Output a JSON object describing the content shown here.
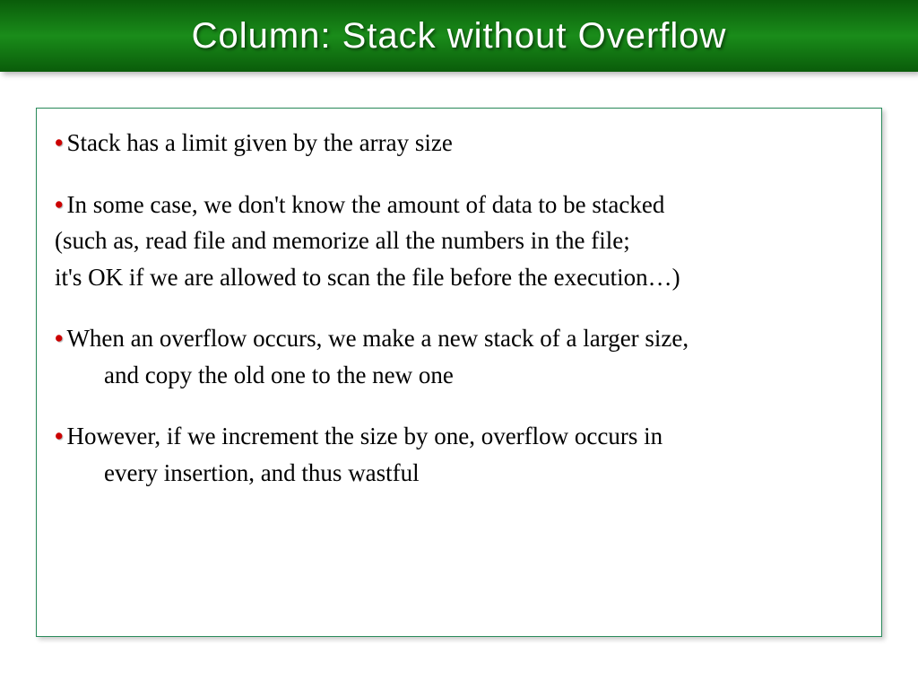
{
  "title": "Column: Stack without Overflow",
  "bullets": [
    {
      "main": "Stack has a limit given by the array size",
      "subs": []
    },
    {
      "main": "In some case, we don't know the amount of data to be stacked",
      "subs": [
        "(such as, read file and memorize all the numbers in the file;",
        " it's OK if we are allowed to scan the file before the execution…)"
      ]
    },
    {
      "main": "When an overflow occurs, we make a new stack of a larger size,",
      "subs_indented": [
        "and copy the old one to the new one"
      ]
    },
    {
      "main": "However, if we increment the size by one, overflow occurs in",
      "subs_indented": [
        "every insertion, and thus wastful"
      ]
    }
  ]
}
